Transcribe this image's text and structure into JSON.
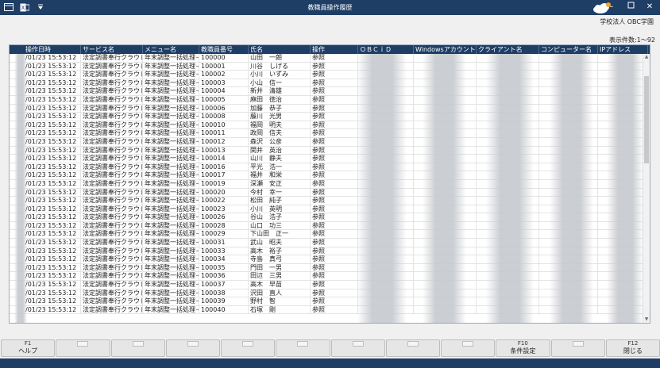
{
  "window": {
    "title": "教職員操作履歴"
  },
  "header": {
    "organization": "学校法人 OBC学園",
    "display_count": "表示件数:1～92"
  },
  "grid": {
    "columns": [
      "操作日時",
      "サービス名",
      "メニュー名",
      "教職員番号",
      "氏名",
      "操作",
      "ＯＢＣｉＤ",
      "Windowsアカウント",
      "クライアント名",
      "コンピューター名",
      "IPアドレス"
    ],
    "rows": [
      [
        "/01/23 15:53:12",
        "法定調書奉行クラウド",
        "年末調整一括処理－",
        "100000",
        "山田　一朗",
        "参照"
      ],
      [
        "/01/23 15:53:12",
        "法定調書奉行クラウド",
        "年末調整一括処理－",
        "100001",
        "川谷　しげる",
        "参照"
      ],
      [
        "/01/23 15:53:12",
        "法定調書奉行クラウド",
        "年末調整一括処理－",
        "100002",
        "小川　いずみ",
        "参照"
      ],
      [
        "/01/23 15:53:12",
        "法定調書奉行クラウド",
        "年末調整一括処理－",
        "100003",
        "小山　信一",
        "参照"
      ],
      [
        "/01/23 15:53:12",
        "法定調書奉行クラウド",
        "年末調整一括処理－",
        "100004",
        "新井　清雄",
        "参照"
      ],
      [
        "/01/23 15:53:12",
        "法定調書奉行クラウド",
        "年末調整一括処理－",
        "100005",
        "麻田　徳治",
        "参照"
      ],
      [
        "/01/23 15:53:12",
        "法定調書奉行クラウド",
        "年末調整一括処理－",
        "100006",
        "加藤　恭子",
        "参照"
      ],
      [
        "/01/23 15:53:12",
        "法定調書奉行クラウド",
        "年末調整一括処理－",
        "100008",
        "藤川　光男",
        "参照"
      ],
      [
        "/01/23 15:53:12",
        "法定調書奉行クラウド",
        "年末調整一括処理－",
        "100010",
        "福岡　明夫",
        "参照"
      ],
      [
        "/01/23 15:53:12",
        "法定調書奉行クラウド",
        "年末調整一括処理－",
        "100011",
        "政岡　信夫",
        "参照"
      ],
      [
        "/01/23 15:53:12",
        "法定調書奉行クラウド",
        "年末調整一括処理－",
        "100012",
        "森沢　公彦",
        "参照"
      ],
      [
        "/01/23 15:53:12",
        "法定調書奉行クラウド",
        "年末調整一括処理－",
        "100013",
        "関井　英治",
        "参照"
      ],
      [
        "/01/23 15:53:12",
        "法定調書奉行クラウド",
        "年末調整一括処理－",
        "100014",
        "山川　静夫",
        "参照"
      ],
      [
        "/01/23 15:53:12",
        "法定調書奉行クラウド",
        "年末調整一括処理－",
        "100016",
        "平光　浩一",
        "参照"
      ],
      [
        "/01/23 15:53:12",
        "法定調書奉行クラウド",
        "年末調整一括処理－",
        "100017",
        "福井　和栄",
        "参照"
      ],
      [
        "/01/23 15:53:12",
        "法定調書奉行クラウド",
        "年末調整一括処理－",
        "100019",
        "深瀬　安正",
        "参照"
      ],
      [
        "/01/23 15:53:12",
        "法定調書奉行クラウド",
        "年末調整一括処理－",
        "100020",
        "今村　幸一",
        "参照"
      ],
      [
        "/01/23 15:53:12",
        "法定調書奉行クラウド",
        "年末調整一括処理－",
        "100022",
        "松田　純子",
        "参照"
      ],
      [
        "/01/23 15:53:12",
        "法定調書奉行クラウド",
        "年末調整一括処理－",
        "100023",
        "小川　英明",
        "参照"
      ],
      [
        "/01/23 15:53:12",
        "法定調書奉行クラウド",
        "年末調整一括処理－",
        "100026",
        "谷山　浩子",
        "参照"
      ],
      [
        "/01/23 15:53:12",
        "法定調書奉行クラウド",
        "年末調整一括処理－",
        "100028",
        "山口　功三",
        "参照"
      ],
      [
        "/01/23 15:53:12",
        "法定調書奉行クラウド",
        "年末調整一括処理－",
        "100029",
        "下山田　正一",
        "参照"
      ],
      [
        "/01/23 15:53:12",
        "法定調書奉行クラウド",
        "年末調整一括処理－",
        "100031",
        "武山　昭夫",
        "参照"
      ],
      [
        "/01/23 15:53:12",
        "法定調書奉行クラウド",
        "年末調整一括処理－",
        "100033",
        "高木　裕子",
        "参照"
      ],
      [
        "/01/23 15:53:12",
        "法定調書奉行クラウド",
        "年末調整一括処理－",
        "100034",
        "寺島　真弓",
        "参照"
      ],
      [
        "/01/23 15:53:12",
        "法定調書奉行クラウド",
        "年末調整一括処理－",
        "100035",
        "門田　一男",
        "参照"
      ],
      [
        "/01/23 15:53:12",
        "法定調書奉行クラウド",
        "年末調整一括処理－",
        "100036",
        "田辺　三男",
        "参照"
      ],
      [
        "/01/23 15:53:12",
        "法定調書奉行クラウド",
        "年末調整一括処理－",
        "100037",
        "高木　早苗",
        "参照"
      ],
      [
        "/01/23 15:53:12",
        "法定調書奉行クラウド",
        "年末調整一括処理－",
        "100038",
        "沢田　直人",
        "参照"
      ],
      [
        "/01/23 15:53:12",
        "法定調書奉行クラウド",
        "年末調整一括処理－",
        "100039",
        "野村　智",
        "参照"
      ],
      [
        "/01/23 15:53:12",
        "法定調書奉行クラウド",
        "年末調整一括処理－",
        "100040",
        "石塚　剛",
        "参照"
      ]
    ]
  },
  "fkeys": [
    {
      "key": "F1",
      "label": "ヘルプ"
    },
    {
      "key": "",
      "label": ""
    },
    {
      "key": "",
      "label": ""
    },
    {
      "key": "",
      "label": ""
    },
    {
      "key": "",
      "label": ""
    },
    {
      "key": "",
      "label": ""
    },
    {
      "key": "",
      "label": ""
    },
    {
      "key": "",
      "label": ""
    },
    {
      "key": "",
      "label": ""
    },
    {
      "key": "F10",
      "label": "条件設定"
    },
    {
      "key": "",
      "label": ""
    },
    {
      "key": "F12",
      "label": "閉じる"
    }
  ],
  "colors": {
    "titlebar": "#1e3e66",
    "header": "#1e3e66"
  },
  "icons": [
    "window-icon",
    "excel-icon",
    "dropdown-menu-icon",
    "cloud-logo-icon",
    "minimize-icon",
    "maximize-icon",
    "close-icon"
  ]
}
